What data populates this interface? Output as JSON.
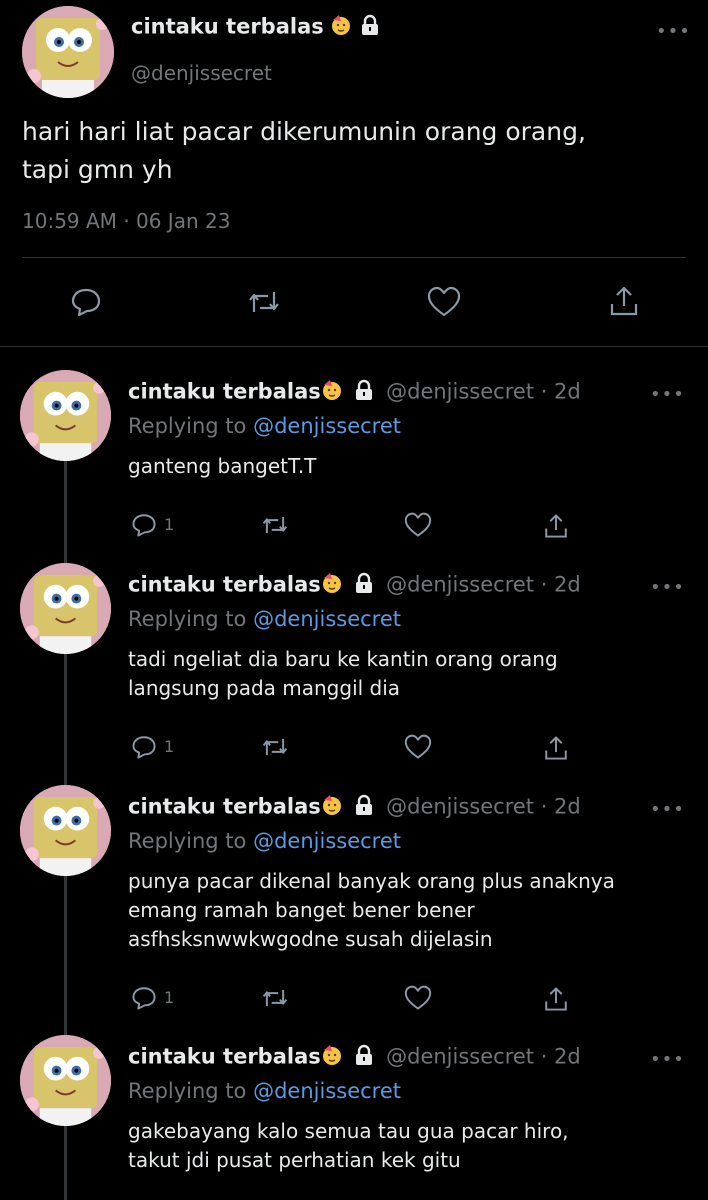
{
  "main_tweet": {
    "display_name": "cintaku terbalas",
    "handle": "@denjissecret",
    "text_lines": [
      "hari hari liat pacar dikerumunin orang orang,",
      "tapi gmn yh"
    ],
    "timestamp": "10:59 AM · 06 Jan 23",
    "more_icon": "more-icon",
    "actions": [
      "reply-icon",
      "retweet-icon",
      "like-icon",
      "share-icon"
    ]
  },
  "replies": [
    {
      "display_name": "cintaku terbalas",
      "meta": "@denjissecret · 2d",
      "replying_prefix": "Replying to",
      "replying_handle": "@denjissecret",
      "text_lines": [
        "ganteng bangetT.T"
      ],
      "reply_count": "1"
    },
    {
      "display_name": "cintaku terbalas",
      "meta": "@denjissecret · 2d",
      "replying_prefix": "Replying to",
      "replying_handle": "@denjissecret",
      "text_lines": [
        "tadi ngeliat dia baru ke kantin orang orang",
        "langsung pada manggil dia"
      ],
      "reply_count": "1"
    },
    {
      "display_name": "cintaku terbalas",
      "meta": "@denjissecret · 2d",
      "replying_prefix": "Replying to",
      "replying_handle": "@denjissecret",
      "text_lines": [
        "punya pacar dikenal banyak orang plus anaknya",
        "emang ramah banget bener bener",
        "asfhsksnwwkwgodne susah dijelasin"
      ],
      "reply_count": "1"
    },
    {
      "display_name": "cintaku terbalas",
      "meta": "@denjissecret · 2d",
      "replying_prefix": "Replying to",
      "replying_handle": "@denjissecret",
      "text_lines": [
        "gakebayang kalo semua tau gua pacar hiro,",
        "takut jdi pusat perhatian kek gitu"
      ],
      "reply_count": ""
    }
  ],
  "colors": {
    "background": "#000000",
    "text": "#e7e9ea",
    "muted": "#71767b",
    "link": "#5b9ae0"
  },
  "icons": {
    "more": "•••",
    "avatar": "spongebob-avatar",
    "verified_emoji": "face-with-party-emoji",
    "lock": "lock-icon"
  }
}
